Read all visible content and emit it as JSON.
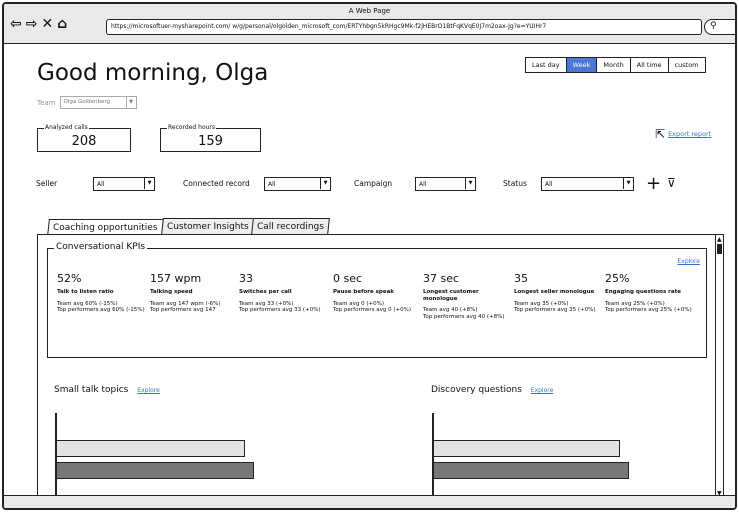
{
  "window": {
    "title": "A Web Page"
  },
  "browser": {
    "url": "https://microsoftuer-mysharepoint.com/ w/g/personal/olgolden_microsoft_com/ERTYhbgn5kRHgc9Mk-f2jHEBrO1BtFqKVqE0J7m2oax-Jg?e=YUIHr7",
    "nav_icons": [
      "back-icon",
      "forward-icon",
      "close-icon",
      "home-icon"
    ],
    "search_icon": "search-icon"
  },
  "header": {
    "greeting": "Good morning, Olga",
    "time_filters": [
      {
        "label": "Last day",
        "active": false
      },
      {
        "label": "Week",
        "active": true
      },
      {
        "label": "Month",
        "active": false
      },
      {
        "label": "All time",
        "active": false
      },
      {
        "label": "custom",
        "active": false
      }
    ],
    "accent_color": "#4a78d6"
  },
  "team": {
    "label": "Team",
    "selected": "Olga Goldenberg"
  },
  "summary": {
    "analyzed_calls": {
      "label": "Analyzed calls",
      "value": "208"
    },
    "recorded_hours": {
      "label": "Recorded hours",
      "value": "159"
    }
  },
  "export": {
    "label": "Export report"
  },
  "filters": {
    "seller": {
      "label": "Seller",
      "value": "All"
    },
    "connected_record": {
      "label": "Connected record",
      "value": "All"
    },
    "campaign": {
      "label": "Campaign",
      "value": "All"
    },
    "status": {
      "label": "Status",
      "value": "All"
    }
  },
  "tabs": [
    {
      "label": "Coaching opportunities",
      "active": true
    },
    {
      "label": "Customer Insights",
      "active": false
    },
    {
      "label": "Call recordings",
      "active": false
    }
  ],
  "kpis": {
    "section_title": "Conversational KPIs",
    "explore_label": "Explore",
    "items": [
      {
        "value": "52%",
        "name": "Talk to listen ratio",
        "desc": "Team avg 60% (-15%)\nTop performers avg 60% (-15%)"
      },
      {
        "value": "157 wpm",
        "name": "Talking speed",
        "desc": "Team avg 147 wpm (-6%)\nTop performers avg 147"
      },
      {
        "value": "33",
        "name": "Switches per call",
        "desc": "Team avg 33 (+0%)\nTop performers avg 33 (+0%)"
      },
      {
        "value": "0 sec",
        "name": "Pause before speak",
        "desc": "Team avg 0 (+0%)\nTop performers avg 0 (+0%)"
      },
      {
        "value": "37 sec",
        "name": "Longest customer monologue",
        "desc": "Team avg 40 (+8%)\nTop performers avg 40 (+8%)"
      },
      {
        "value": "35",
        "name": "Longest seller monologue",
        "desc": "Team avg 35 (+0%)\nTop performers avg 35 (+0%)"
      },
      {
        "value": "25%",
        "name": "Engaging questions rate",
        "desc": "Team avg 25% (+0%)\nTop performers avg 25% (+0%)"
      }
    ]
  },
  "charts": {
    "small_talk": {
      "title": "Small talk topics",
      "explore_label": "Explore"
    },
    "discovery": {
      "title": "Discovery questions",
      "explore_label": "Explore"
    }
  }
}
